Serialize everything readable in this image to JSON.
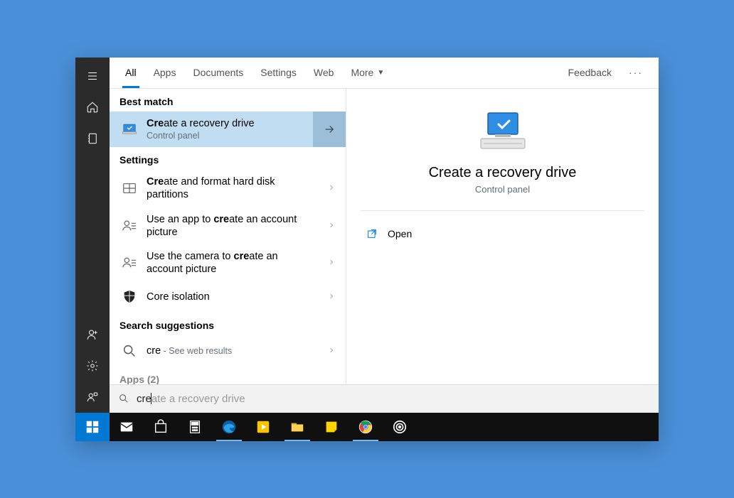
{
  "tabs": {
    "all": "All",
    "apps": "Apps",
    "documents": "Documents",
    "settings": "Settings",
    "web": "Web",
    "more": "More",
    "feedback": "Feedback"
  },
  "sections": {
    "best_match": "Best match",
    "settings": "Settings",
    "search_suggestions": "Search suggestions",
    "apps_count_label": "Apps (2)"
  },
  "best_match": {
    "title_prefix_bold": "Cre",
    "title_rest": "ate a recovery drive",
    "sub": "Control panel"
  },
  "settings_results": [
    {
      "t1": "Cre",
      "t2": "ate and format hard disk partitions"
    },
    {
      "t1": "Use an app to ",
      "tb": "cre",
      "t2": "ate an account picture"
    },
    {
      "t1": "Use the camera to ",
      "tb": "cre",
      "t2": "ate an account picture"
    },
    {
      "t1": "Co",
      "tb": "re",
      "t2": " isolation",
      "plain": "Core isolation"
    }
  ],
  "suggestion": {
    "query": "cre",
    "hint": " - See web results"
  },
  "search": {
    "typed": "cre",
    "ghost": "ate a recovery drive"
  },
  "preview": {
    "title": "Create a recovery drive",
    "sub": "Control panel"
  },
  "actions": {
    "open": "Open"
  }
}
